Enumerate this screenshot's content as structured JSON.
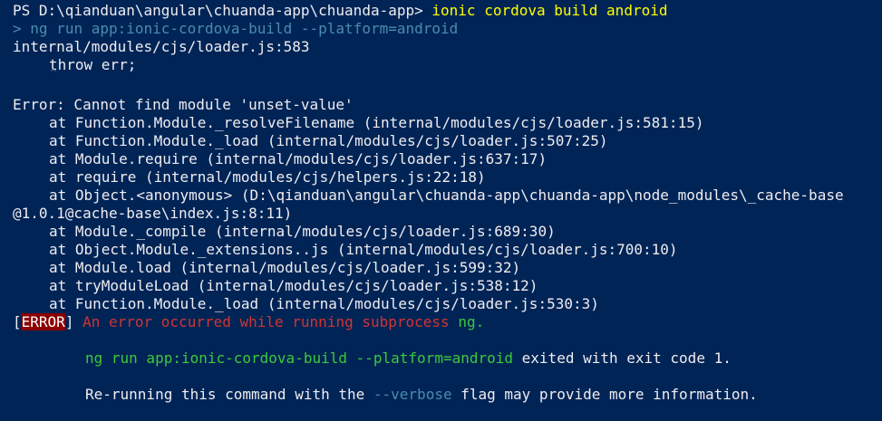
{
  "prompt": {
    "prefix": "PS D:\\qianduan\\angular\\chuanda-app\\chuanda-app>",
    "command": "ionic cordova build android"
  },
  "run_line": {
    "arrow": ">",
    "text": "ng run app:ionic-cordova-build --platform=android"
  },
  "loader_line": "internal/modules/cjs/loader.js:583",
  "throw_line": "throw err;",
  "caret": "^",
  "error_line": "Error: Cannot find module 'unset-value'",
  "stack": [
    "at Function.Module._resolveFilename (internal/modules/cjs/loader.js:581:15)",
    "at Function.Module._load (internal/modules/cjs/loader.js:507:25)",
    "at Module.require (internal/modules/cjs/loader.js:637:17)",
    "at require (internal/modules/cjs/helpers.js:22:18)",
    "at Object.<anonymous> (D:\\qianduan\\angular\\chuanda-app\\chuanda-app\\node_modules\\_cache-base",
    "@1.0.1@cache-base\\index.js:8:11)",
    "at Module._compile (internal/modules/cjs/loader.js:689:30)",
    "at Object.Module._extensions..js (internal/modules/cjs/loader.js:700:10)",
    "at Module.load (internal/modules/cjs/loader.js:599:32)",
    "at tryModuleLoad (internal/modules/cjs/loader.js:538:12)",
    "at Function.Module._load (internal/modules/cjs/loader.js:530:3)"
  ],
  "error_banner": {
    "open": "[",
    "tag": "ERROR",
    "close": "]",
    "message": "An error occurred while running subprocess",
    "process": "ng."
  },
  "exit_line": {
    "command": "ng run app:ionic-cordova-build --platform=android",
    "suffix": "exited with exit code 1."
  },
  "rerun_line": {
    "before": "Re-running this command with the",
    "flag": "--verbose",
    "after": "flag may provide more information."
  }
}
